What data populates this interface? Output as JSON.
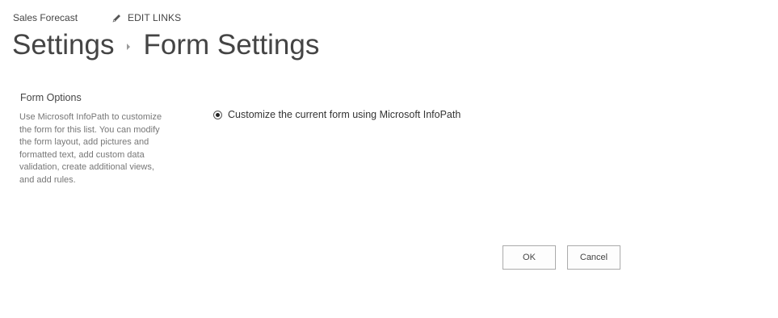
{
  "header": {
    "site_name": "Sales Forecast",
    "edit_links_label": "EDIT LINKS",
    "edit_links_icon": "pencil-icon"
  },
  "breadcrumb": {
    "parent": "Settings",
    "separator_icon": "triangle-right-icon",
    "current": "Form Settings"
  },
  "form_options": {
    "heading": "Form Options",
    "description": "Use Microsoft InfoPath to customize the form for this list. You can modify the form layout, add pictures and formatted text, add custom data validation, create additional views, and add rules.",
    "options": [
      {
        "label": "Customize the current form using Microsoft InfoPath",
        "selected": true
      }
    ]
  },
  "actions": {
    "ok_label": "OK",
    "cancel_label": "Cancel"
  }
}
